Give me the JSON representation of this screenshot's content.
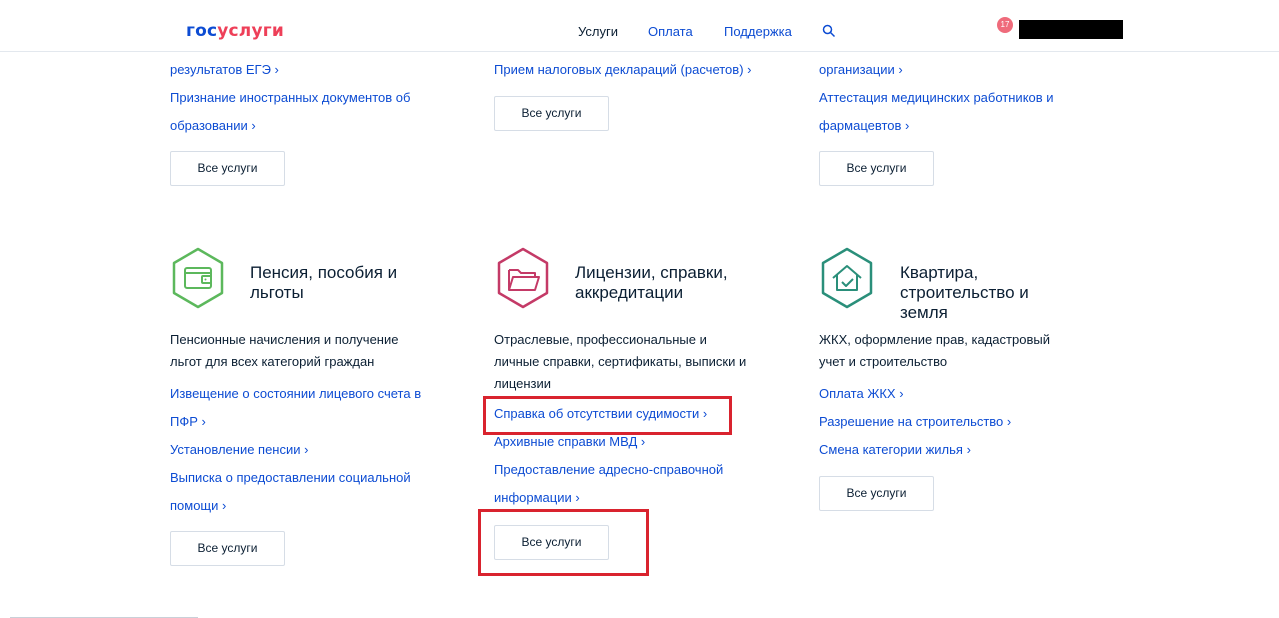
{
  "header": {
    "logo_gos": "гос",
    "logo_uslugi": "услуги",
    "nav": {
      "uslugi": "Услуги",
      "oplata": "Оплата",
      "support": "Поддержка"
    },
    "notifications_count": "17"
  },
  "top": {
    "col1_links": [
      "результатов ЕГЭ",
      "Признание иностранных документов об",
      "образовании"
    ],
    "col2_links": [
      "Прием налоговых деклараций (расчетов)"
    ],
    "col3_links": [
      "организации",
      "Аттестация медицинских работников и",
      "фармацевтов"
    ]
  },
  "all_services_label": "Все услуги",
  "arrow": "›",
  "categories": [
    {
      "title_line1": "Пенсия, пособия и",
      "title_line2": "льготы",
      "desc_line1": "Пенсионные начисления и получение",
      "desc_line2": "льгот для всех категорий граждан",
      "links": [
        "Извещение о состоянии лицевого счета в",
        "ПФР",
        "Установление пенсии",
        "Выписка о предоставлении социальной",
        "помощи"
      ],
      "color": "#5cb85c"
    },
    {
      "title_line1": "Лицензии, справки,",
      "title_line2": "аккредитации",
      "desc_line1": "Отраслевые, профессиональные и",
      "desc_line2": "личные справки, сертификаты, выписки и",
      "desc_line3": "лицензии",
      "links": [
        "Справка об отсутствии судимости",
        "Архивные справки МВД",
        "Предоставление адресно-справочной",
        "информации"
      ],
      "color": "#c43a67"
    },
    {
      "title_line1": "Квартира,",
      "title_line2": "строительство и",
      "title_line3": "земля",
      "desc_line1": "ЖКХ, оформление прав, кадастровый",
      "desc_line2": "учет и строительство",
      "links": [
        "Оплата ЖКХ",
        "Разрешение на строительство",
        "Смена категории жилья"
      ],
      "color": "#2a8f7a"
    }
  ],
  "colors": {
    "link": "#0d4cd3",
    "highlight": "#d9232e"
  }
}
